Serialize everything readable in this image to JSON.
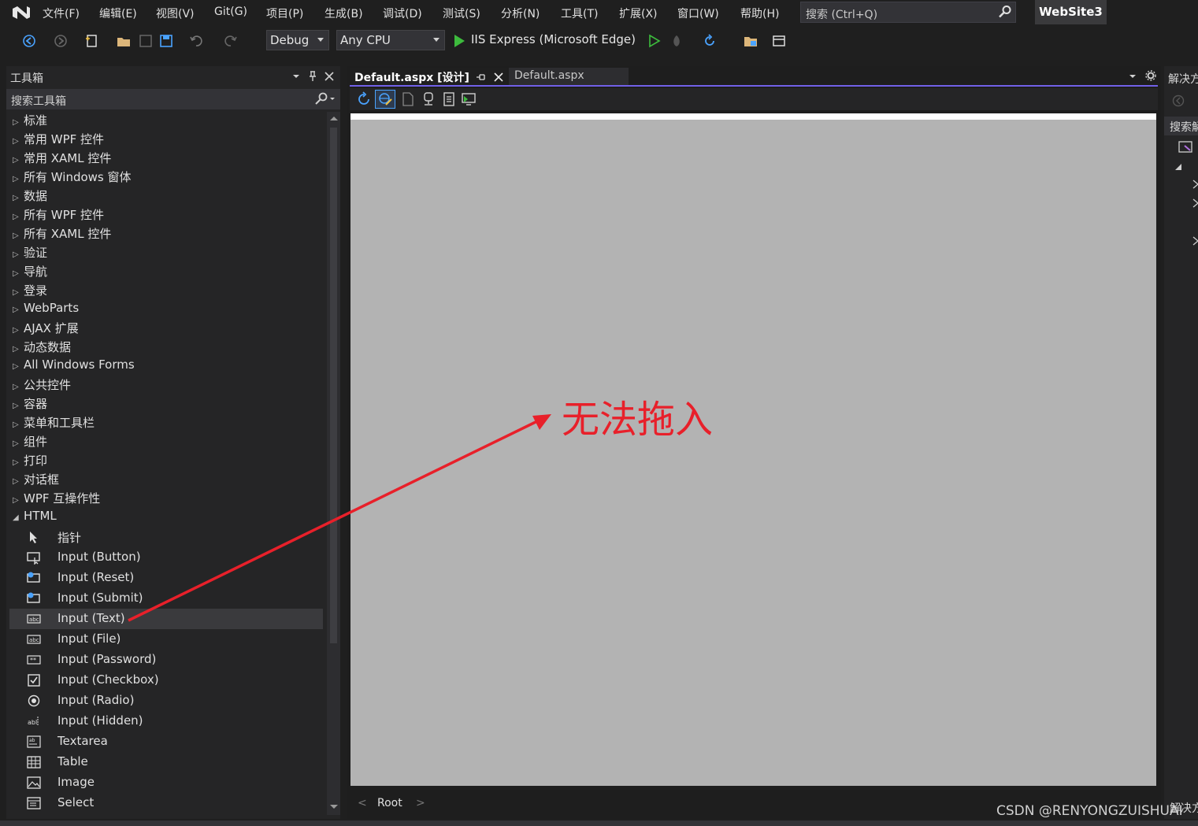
{
  "menu": {
    "items": [
      "文件(F)",
      "编辑(E)",
      "视图(V)",
      "Git(G)",
      "项目(P)",
      "生成(B)",
      "调试(D)",
      "测试(S)",
      "分析(N)",
      "工具(T)",
      "扩展(X)",
      "窗口(W)",
      "帮助(H)"
    ],
    "search_placeholder": "搜索 (Ctrl+Q)",
    "solution_name": "WebSite3"
  },
  "toolbar": {
    "configuration": "Debug",
    "platform": "Any CPU",
    "run_target": "IIS Express (Microsoft Edge)"
  },
  "toolbox": {
    "title": "工具箱",
    "search_placeholder": "搜索工具箱",
    "categories": [
      "标准",
      "常用 WPF 控件",
      "常用 XAML 控件",
      "所有 Windows 窗体",
      "数据",
      "所有 WPF 控件",
      "所有 XAML 控件",
      "验证",
      "导航",
      "登录",
      "WebParts",
      "AJAX 扩展",
      "动态数据",
      "All Windows Forms",
      "公共控件",
      "容器",
      "菜单和工具栏",
      "组件",
      "打印",
      "对话框",
      "WPF 互操作性"
    ],
    "expanded_category": "HTML",
    "html_items": [
      "指针",
      "Input (Button)",
      "Input (Reset)",
      "Input (Submit)",
      "Input (Text)",
      "Input (File)",
      "Input (Password)",
      "Input (Checkbox)",
      "Input (Radio)",
      "Input (Hidden)",
      "Textarea",
      "Table",
      "Image",
      "Select"
    ],
    "selected_item": "Input (Text)"
  },
  "editor": {
    "tab_active": "Default.aspx [设计]",
    "tab_inactive": "Default.aspx",
    "breadcrumb_root": "Root"
  },
  "solution_explorer": {
    "title_fragment": "解决方",
    "search_fragment": "搜索解",
    "bottom_fragment": "解决方"
  },
  "annotation": {
    "text": "无法拖入",
    "color": "#e8202a"
  },
  "watermark": "CSDN @RENYONGZUISHUAI",
  "colors": {
    "accent": "#7160e8",
    "run_green": "#3dbb3d",
    "canvas": "#b3b3b3"
  }
}
